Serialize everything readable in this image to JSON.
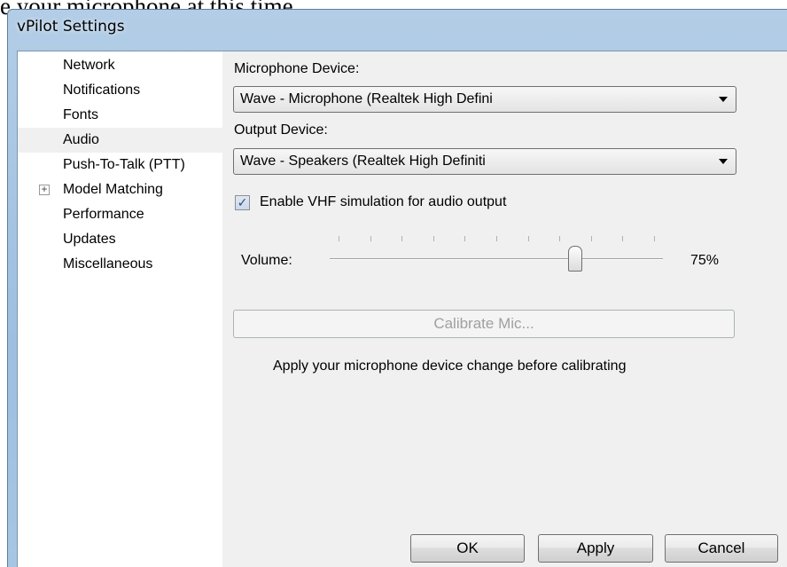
{
  "background": {
    "text": "e your microphone at this time."
  },
  "window": {
    "title": "vPilot Settings"
  },
  "sidebar": {
    "items": [
      {
        "label": "Network",
        "selected": false
      },
      {
        "label": "Notifications",
        "selected": false
      },
      {
        "label": "Fonts",
        "selected": false
      },
      {
        "label": "Audio",
        "selected": true
      },
      {
        "label": "Push-To-Talk (PTT)",
        "selected": false
      },
      {
        "label": "Model Matching",
        "selected": false,
        "expander": "+"
      },
      {
        "label": "Performance",
        "selected": false
      },
      {
        "label": "Updates",
        "selected": false
      },
      {
        "label": "Miscellaneous",
        "selected": false
      }
    ]
  },
  "audio": {
    "mic_label": "Microphone Device:",
    "mic_value": "Wave - Microphone (Realtek High Defini",
    "output_label": "Output Device:",
    "output_value": "Wave - Speakers (Realtek High Definiti",
    "vhf_label": "Enable VHF simulation for audio output",
    "vhf_checked": true,
    "vhf_check_glyph": "✓",
    "volume_label": "Volume:",
    "volume_value": 0.75,
    "volume_text": "75%",
    "calibrate_label": "Calibrate Mic...",
    "hint": "Apply your microphone device change before calibrating"
  },
  "footer": {
    "ok_label": "OK",
    "apply_label": "Apply",
    "cancel_label": "Cancel"
  }
}
